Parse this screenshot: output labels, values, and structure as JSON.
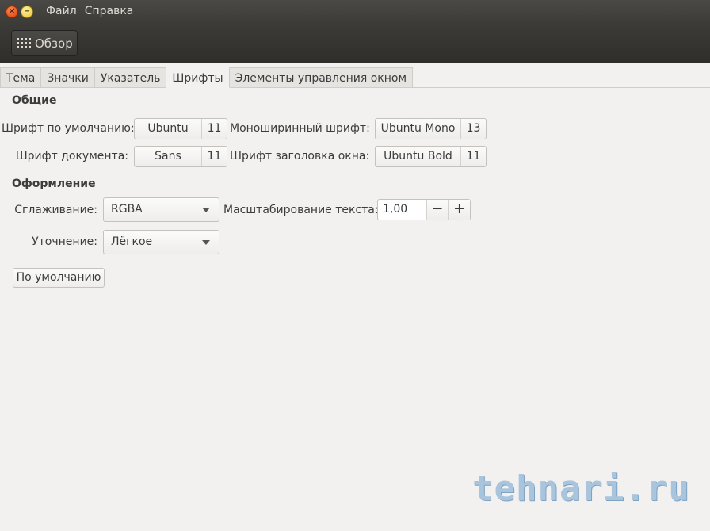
{
  "window": {
    "menu": [
      "Файл",
      "Справка"
    ]
  },
  "toolbar": {
    "overview_label": "Обзор"
  },
  "tabs": [
    {
      "label": "Тема",
      "active": false
    },
    {
      "label": "Значки",
      "active": false
    },
    {
      "label": "Указатель",
      "active": false
    },
    {
      "label": "Шрифты",
      "active": true
    },
    {
      "label": "Элементы управления окном",
      "active": false
    }
  ],
  "general": {
    "heading": "Общие",
    "default_font": {
      "label": "Шрифт по умолчанию:",
      "name": "Ubuntu",
      "size": "11"
    },
    "mono_font": {
      "label": "Моноширинный шрифт:",
      "name": "Ubuntu Mono",
      "size": "13"
    },
    "document_font": {
      "label": "Шрифт документа:",
      "name": "Sans",
      "size": "11"
    },
    "title_font": {
      "label": "Шрифт заголовка окна:",
      "name": "Ubuntu Bold",
      "size": "11"
    }
  },
  "appearance": {
    "heading": "Оформление",
    "antialiasing": {
      "label": "Сглаживание:",
      "value": "RGBA"
    },
    "hinting": {
      "label": "Уточнение:",
      "value": "Лёгкое"
    },
    "text_scaling": {
      "label": "Масштабирование текста:",
      "value": "1,00",
      "minus": "−",
      "plus": "+"
    }
  },
  "default_button": "По умолчанию",
  "watermark": "tehnari.ru",
  "colors": {
    "titlebar": "#3c3b37",
    "close_button": "#e4501a",
    "minimize_button": "#f2d14a",
    "window_bg": "#f2f1f0",
    "watermark": "#a9c4dd"
  }
}
